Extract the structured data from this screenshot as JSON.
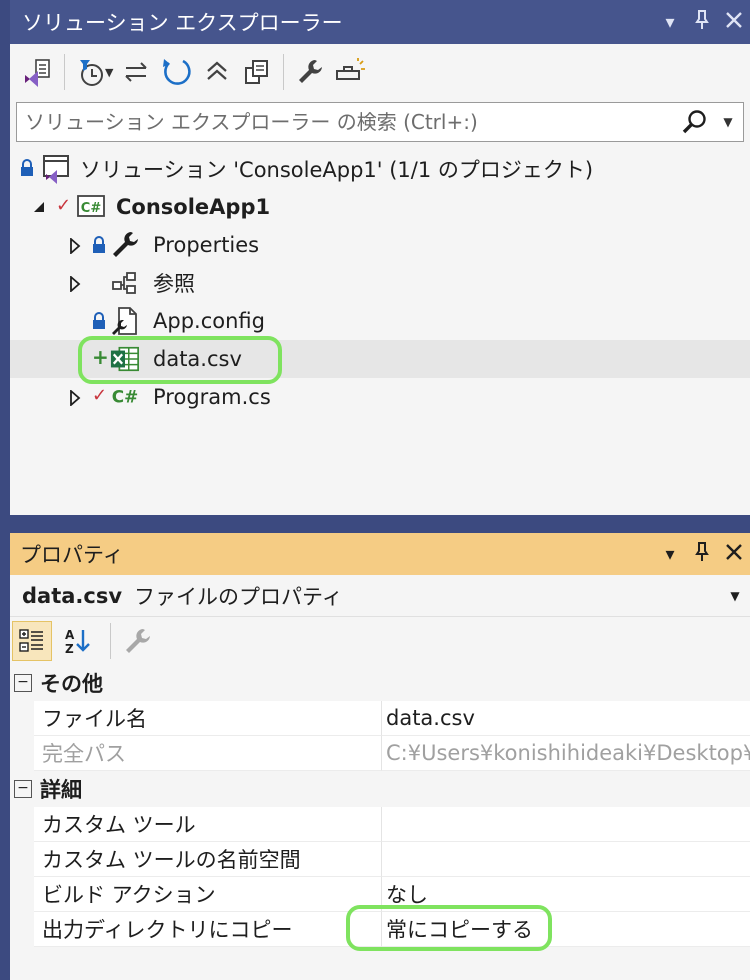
{
  "solution_explorer": {
    "title": "ソリューション エクスプローラー",
    "search": {
      "placeholder": "ソリューション エクスプローラー の検索 (Ctrl+:)"
    },
    "tree": {
      "solution": "ソリューション 'ConsoleApp1' (1/1 のプロジェクト)",
      "project": "ConsoleApp1",
      "properties": "Properties",
      "references": "参照",
      "app_config": "App.config",
      "data_csv": "data.csv",
      "program_cs": "Program.cs"
    },
    "icon_text": {
      "csharp": "C#"
    }
  },
  "properties": {
    "title": "プロパティ",
    "object_name": "data.csv",
    "object_type": "ファイルのプロパティ",
    "categories": {
      "other": {
        "name": "その他",
        "rows": [
          {
            "name": "ファイル名",
            "value": "data.csv"
          },
          {
            "name": "完全パス",
            "value": "C:¥Users¥konishihideaki¥Desktop¥C"
          }
        ]
      },
      "advanced": {
        "name": "詳細",
        "rows": [
          {
            "name": "カスタム ツール",
            "value": ""
          },
          {
            "name": "カスタム ツールの名前空間",
            "value": ""
          },
          {
            "name": "ビルド アクション",
            "value": "なし"
          },
          {
            "name": "出力ディレクトリにコピー",
            "value": "常にコピーする"
          }
        ]
      }
    }
  },
  "colors": {
    "se_titlebar": "#46558d",
    "props_titlebar": "#f5cc84",
    "highlight_ring": "#7fe35f",
    "vs_purple": "#68217a",
    "csharp_green": "#388a34",
    "blue_accent": "#1c6fc7"
  }
}
